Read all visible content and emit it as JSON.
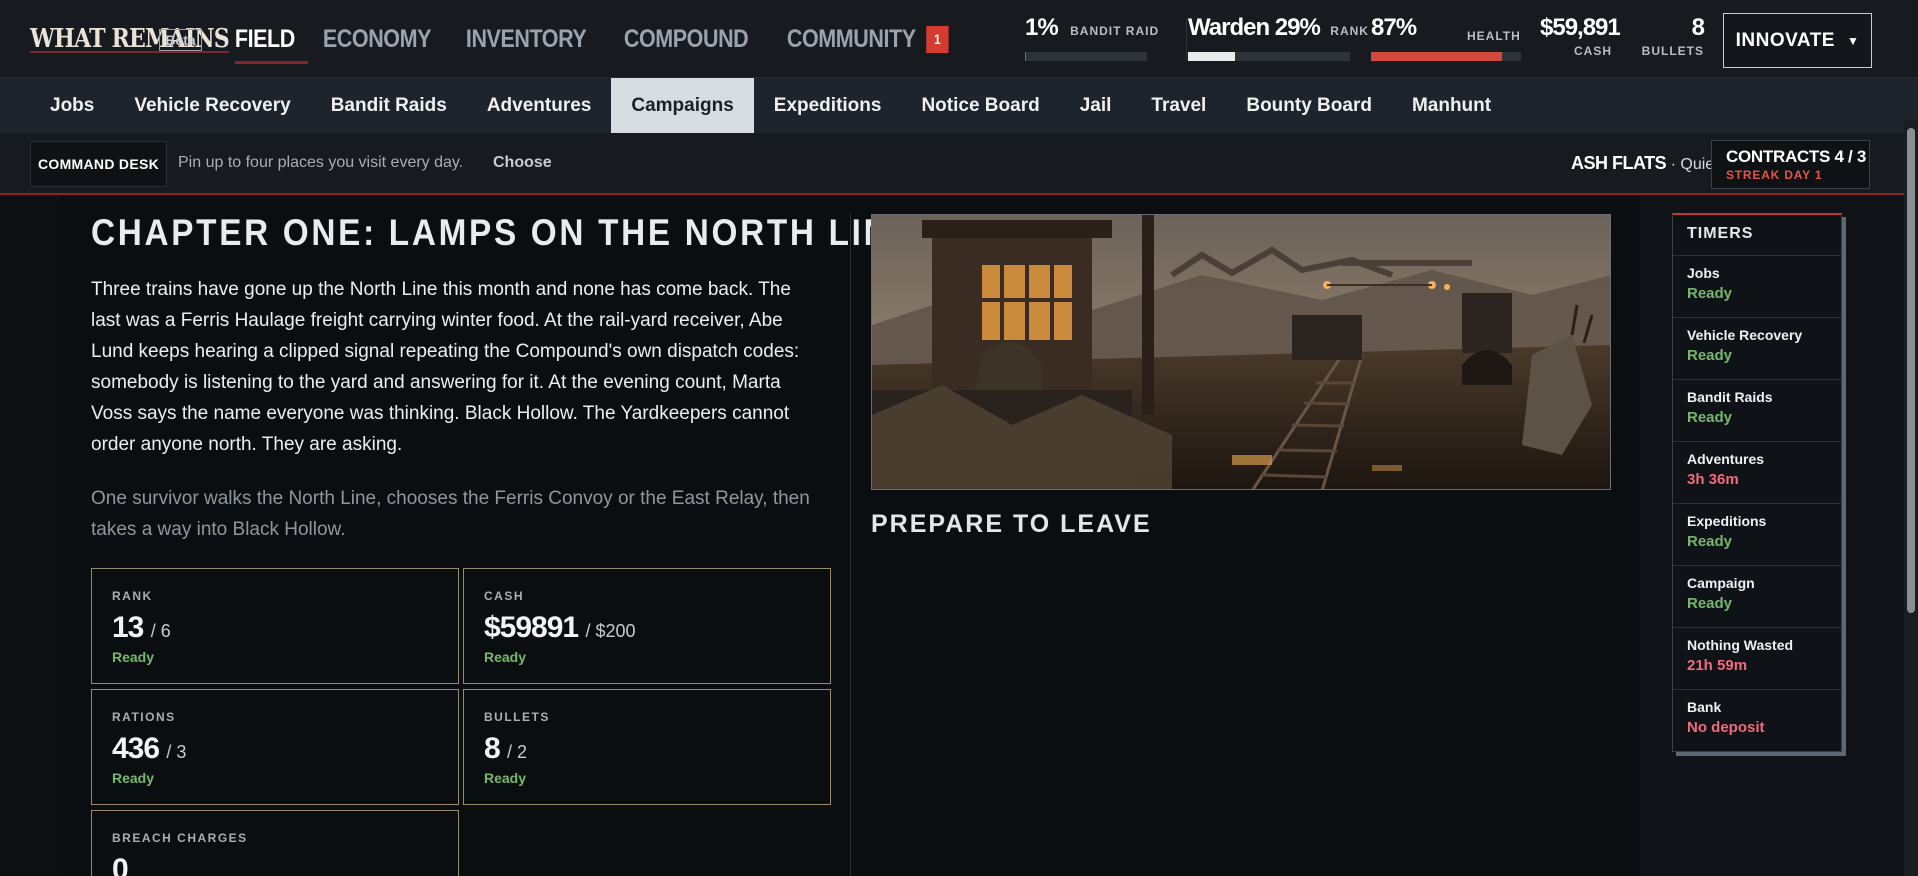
{
  "app": {
    "logo": "WHAT REMAINS",
    "beta": "Beta"
  },
  "main_nav": [
    {
      "label": "FIELD",
      "active": true
    },
    {
      "label": "ECONOMY",
      "active": false
    },
    {
      "label": "INVENTORY",
      "active": false
    },
    {
      "label": "COMPOUND",
      "active": false
    },
    {
      "label": "COMMUNITY",
      "active": false,
      "badge": "1"
    }
  ],
  "stats": {
    "bandit_raid": {
      "value": "1%",
      "label": "BANDIT RAID",
      "level": 0.01
    },
    "rank": {
      "value": "Warden 29%",
      "label": "RANK",
      "level": 0.29,
      "color": "#e8eaec"
    },
    "health": {
      "value": "87%",
      "label": "HEALTH",
      "level": 0.87,
      "color": "#d2483c"
    },
    "cash": {
      "value": "$59,891",
      "label": "CASH"
    },
    "bullets": {
      "value": "8",
      "label": "BULLETS"
    }
  },
  "innovate_button": "INNOVATE",
  "sub_nav": [
    {
      "label": "Jobs",
      "active": false
    },
    {
      "label": "Vehicle Recovery",
      "active": false
    },
    {
      "label": "Bandit Raids",
      "active": false
    },
    {
      "label": "Adventures",
      "active": false
    },
    {
      "label": "Campaigns",
      "active": true
    },
    {
      "label": "Expeditions",
      "active": false
    },
    {
      "label": "Notice Board",
      "active": false
    },
    {
      "label": "Jail",
      "active": false
    },
    {
      "label": "Travel",
      "active": false
    },
    {
      "label": "Bounty Board",
      "active": false
    },
    {
      "label": "Manhunt",
      "active": false
    }
  ],
  "command": {
    "desk_label": "COMMAND DESK",
    "hint": "Pin up to four places you visit every day.",
    "choose": "Choose",
    "region_name": "ASH FLATS",
    "region_sep": "·",
    "region_status": "Quiet",
    "contracts": "CONTRACTS 4 / 3",
    "streak": "STREAK DAY 1"
  },
  "campaign": {
    "title": "CHAPTER ONE: LAMPS ON THE NORTH LINE",
    "story": "Three trains have gone up the North Line this month and none has come back. The last was a Ferris Haulage freight carrying winter food. At the rail-yard receiver, Abe Lund keeps hearing a clipped signal repeating the Compound's own dispatch codes: somebody is listening to the yard and answering for it. At the evening count, Marta Voss says the name everyone was thinking. Black Hollow. The Yardkeepers cannot order anyone north. They are asking.",
    "summary": "One survivor walks the North Line, chooses the Ferris Convoy or the East Relay, then takes a way into Black Hollow.",
    "requirements": [
      {
        "label": "RANK",
        "value": "13",
        "required": "/ 6",
        "status": "Ready"
      },
      {
        "label": "CASH",
        "value": "$59891",
        "required": "/ $200",
        "status": "Ready"
      },
      {
        "label": "RATIONS",
        "value": "436",
        "required": "/ 3",
        "status": "Ready"
      },
      {
        "label": "BULLETS",
        "value": "8",
        "required": "/ 2",
        "status": "Ready"
      },
      {
        "label": "BREACH CHARGES",
        "value": "0",
        "required": "",
        "status": ""
      }
    ],
    "prepare": "PREPARE TO LEAVE"
  },
  "timers": {
    "title": "TIMERS",
    "items": [
      {
        "name": "Jobs",
        "value": "Ready",
        "state": "ready"
      },
      {
        "name": "Vehicle Recovery",
        "value": "Ready",
        "state": "ready"
      },
      {
        "name": "Bandit Raids",
        "value": "Ready",
        "state": "ready"
      },
      {
        "name": "Adventures",
        "value": "3h 36m",
        "state": "waiting"
      },
      {
        "name": "Expeditions",
        "value": "Ready",
        "state": "ready"
      },
      {
        "name": "Campaign",
        "value": "Ready",
        "state": "ready"
      },
      {
        "name": "Nothing Wasted",
        "value": "21h 59m",
        "state": "waiting"
      },
      {
        "name": "Bank",
        "value": "No deposit",
        "state": "waiting"
      }
    ]
  },
  "colors": {
    "accent": "#8a2323",
    "ready": "#76b86b",
    "waiting": "#f06b7c",
    "badge": "#d63b2f"
  }
}
